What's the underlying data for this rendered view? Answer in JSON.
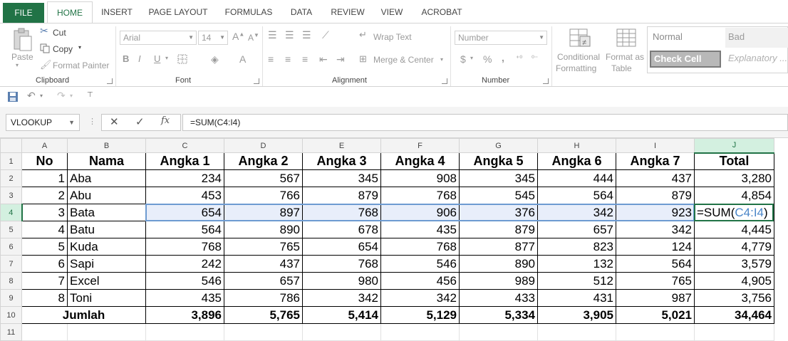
{
  "tabs": [
    "FILE",
    "HOME",
    "INSERT",
    "PAGE LAYOUT",
    "FORMULAS",
    "DATA",
    "REVIEW",
    "VIEW",
    "ACROBAT"
  ],
  "ribbon": {
    "clipboard": {
      "paste": "Paste",
      "cut": "Cut",
      "copy": "Copy",
      "format_painter": "Format Painter",
      "label": "Clipboard"
    },
    "font": {
      "name": "Arial",
      "size": "14",
      "label": "Font",
      "bold": "B",
      "italic": "I",
      "underline": "U"
    },
    "alignment": {
      "wrap_text": "Wrap Text",
      "merge_center": "Merge & Center",
      "label": "Alignment"
    },
    "number": {
      "format": "Number",
      "currency": "$",
      "percent": "%",
      "comma": ",",
      "label": "Number"
    },
    "styles": {
      "conditional1": "Conditional",
      "conditional2": "Formatting",
      "format_table1": "Format as",
      "format_table2": "Table",
      "normal": "Normal",
      "bad": "Bad",
      "check_cell": "Check Cell",
      "explanatory": "Explanatory ..."
    }
  },
  "formula_bar": {
    "name_box": "VLOOKUP",
    "fx": "fx",
    "cancel": "✕",
    "enter": "✓",
    "formula": "=SUM(C4:I4)"
  },
  "columns": [
    "A",
    "B",
    "C",
    "D",
    "E",
    "F",
    "G",
    "H",
    "I",
    "J"
  ],
  "header_row": [
    "No",
    "Nama",
    "Angka 1",
    "Angka 2",
    "Angka 3",
    "Angka 4",
    "Angka 5",
    "Angka 6",
    "Angka 7",
    "Total"
  ],
  "rows": [
    [
      "1",
      "Aba",
      "234",
      "567",
      "345",
      "908",
      "345",
      "444",
      "437",
      "3,280"
    ],
    [
      "2",
      "Abu",
      "453",
      "766",
      "879",
      "768",
      "545",
      "564",
      "879",
      "4,854"
    ],
    [
      "3",
      "Bata",
      "654",
      "897",
      "768",
      "906",
      "376",
      "342",
      "923",
      ""
    ],
    [
      "4",
      "Batu",
      "564",
      "890",
      "678",
      "435",
      "879",
      "657",
      "342",
      "4,445"
    ],
    [
      "5",
      "Kuda",
      "768",
      "765",
      "654",
      "768",
      "877",
      "823",
      "124",
      "4,779"
    ],
    [
      "6",
      "Sapi",
      "242",
      "437",
      "768",
      "546",
      "890",
      "132",
      "564",
      "3,579"
    ],
    [
      "7",
      "Excel",
      "546",
      "657",
      "980",
      "456",
      "989",
      "512",
      "765",
      "4,905"
    ],
    [
      "8",
      "Toni",
      "435",
      "786",
      "342",
      "342",
      "433",
      "431",
      "987",
      "3,756"
    ]
  ],
  "editing_cell": {
    "prefix": "=SUM(",
    "ref": "C4:I4",
    "suffix": ")"
  },
  "total_row": {
    "label": "Jumlah",
    "values": [
      "3,896",
      "5,765",
      "5,414",
      "5,129",
      "5,334",
      "3,905",
      "5,021",
      "34,464"
    ]
  },
  "row_numbers": [
    "1",
    "2",
    "3",
    "4",
    "5",
    "6",
    "7",
    "8",
    "9",
    "10",
    "11"
  ],
  "colors": {
    "excel_green": "#217346",
    "range_blue": "#6d9bd1"
  }
}
